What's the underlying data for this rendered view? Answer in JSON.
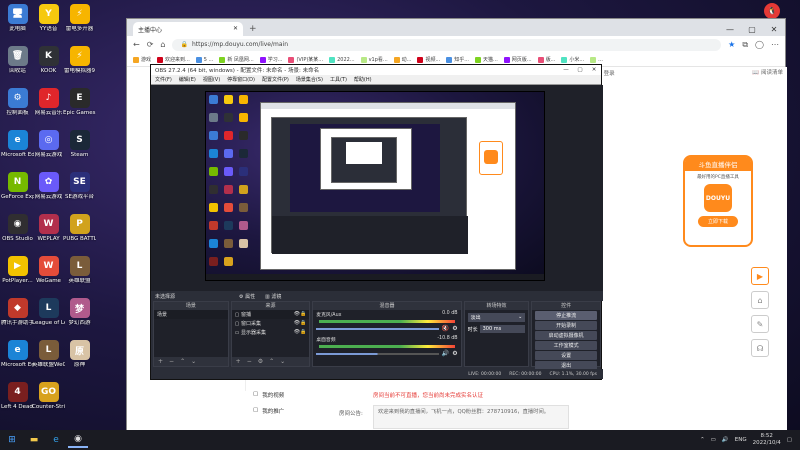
{
  "desktop": {
    "icons": [
      {
        "label": "此电脑",
        "glyph": "🖥",
        "color": "#3b7bd4"
      },
      {
        "label": "YY语音",
        "glyph": "Y",
        "color": "#f6c90e"
      },
      {
        "label": "雷电多开器",
        "glyph": "⚡",
        "color": "#f7b500"
      },
      {
        "label": "回收站",
        "glyph": "🗑",
        "color": "#6c7a89"
      },
      {
        "label": "KOOK",
        "glyph": "K",
        "color": "#2f3136"
      },
      {
        "label": "雷电模拟器9",
        "glyph": "⚡",
        "color": "#f7b500"
      },
      {
        "label": "控制面板",
        "glyph": "⚙",
        "color": "#3b7bd4"
      },
      {
        "label": "网易云音乐",
        "glyph": "♪",
        "color": "#e0262b"
      },
      {
        "label": "Epic Games Launcher",
        "glyph": "E",
        "color": "#2a2a2a"
      },
      {
        "label": "Microsoft Edge",
        "glyph": "e",
        "color": "#1b84d6"
      },
      {
        "label": "网易云游戏",
        "glyph": "◎",
        "color": "#5b6af0"
      },
      {
        "label": "Steam",
        "glyph": "S",
        "color": "#1b2838"
      },
      {
        "label": "GeForce Experience",
        "glyph": "N",
        "color": "#76b900"
      },
      {
        "label": "网易云游戏",
        "glyph": "✿",
        "color": "#6a5af9"
      },
      {
        "label": "SE游戏平台",
        "glyph": "SE",
        "color": "#2b2f7a"
      },
      {
        "label": "OBS Studio",
        "glyph": "◉",
        "color": "#302e31"
      },
      {
        "label": "WEPLAY",
        "glyph": "W",
        "color": "#b22f4c"
      },
      {
        "label": "PUBG BATTLEGR...",
        "glyph": "P",
        "color": "#d1a21d"
      },
      {
        "label": "PotPlayer...",
        "glyph": "▶",
        "color": "#f2c200"
      },
      {
        "label": "WeGame",
        "glyph": "W",
        "color": "#e44c3a"
      },
      {
        "label": "英雄联盟",
        "glyph": "L",
        "color": "#7a5c3a"
      },
      {
        "label": "腾讯手游助手",
        "glyph": "◆",
        "color": "#c0392b"
      },
      {
        "label": "League of Legends",
        "glyph": "L",
        "color": "#1d3a5c"
      },
      {
        "label": "梦幻西游",
        "glyph": "梦",
        "color": "#b05a8c"
      },
      {
        "label": "Microsoft Edge",
        "glyph": "e",
        "color": "#1b84d6"
      },
      {
        "label": "英雄联盟WeGame版",
        "glyph": "L",
        "color": "#7a5c3a"
      },
      {
        "label": "原神",
        "glyph": "原",
        "color": "#d8c3a5"
      },
      {
        "label": "Left 4 Dead 2",
        "glyph": "4",
        "color": "#7a1f1f"
      },
      {
        "label": "Counter-Strike Global Off...",
        "glyph": "GO",
        "color": "#d8a21d"
      }
    ]
  },
  "browser": {
    "tab_title": "主播中心",
    "url": "https://mp.douyu.com/live/main",
    "bookmarks": [
      "游戏",
      "欢迎来到...",
      "5 ...",
      "新 凤凰网...",
      "学习...",
      "(VIP)某某...",
      "2022...",
      "v1p看...",
      "动...",
      "视频...",
      "知乎...",
      "天猫...",
      "网页版...",
      "版...",
      "小米...",
      "..."
    ],
    "user_icon_label": "登录",
    "reading_list": "阅读清单",
    "promo": {
      "title": "斗鱼直播伴侣",
      "subtitle": "最好用的PC直播工具",
      "logo_text": "DOUYU",
      "download": "立即下载"
    },
    "menu": [
      {
        "label": "我的视频",
        "icon": "▢"
      },
      {
        "label": "我的推广",
        "icon": "▢"
      }
    ],
    "red_notice": "房间当前不可直播，您当前尚未完成实名认证",
    "announce_label": "房间公告:",
    "announce_text": "欢迎来到我的直播间，飞机一点，QQ粉丝群：278710916，直播时间。"
  },
  "obs": {
    "title": "OBS 27.2.4 (64 bit, windows) - 配置文件: 未命名 - 场景: 未命名",
    "menu": [
      "文件(F)",
      "编辑(E)",
      "视图(V)",
      "停靠窗口(D)",
      "配置文件(P)",
      "场景集合(S)",
      "工具(T)",
      "帮助(H)"
    ],
    "preview_label": "未选择源",
    "tools": {
      "props": "属性",
      "filters": "滤镜"
    },
    "docks": {
      "scenes": {
        "title": "场景",
        "items": [
          "场景"
        ]
      },
      "sources": {
        "title": "来源",
        "items": [
          "窗捕",
          "窗口采集",
          "显示器采集"
        ]
      },
      "mixer": {
        "title": "混音器",
        "channels": [
          {
            "name": "麦克风/Aux",
            "db": "0.0 dB"
          },
          {
            "name": "桌面音频",
            "db": "-10.8 dB"
          }
        ]
      },
      "transitions": {
        "title": "转场特效",
        "type": "淡出",
        "duration_label": "时长",
        "duration": "300 ms"
      },
      "controls": {
        "title": "控件",
        "buttons": [
          "停止推流",
          "开始录制",
          "启动虚拟摄像机",
          "工作室模式",
          "设置",
          "退出"
        ]
      }
    },
    "status": {
      "live": "LIVE: 00:00:00",
      "rec": "REC: 00:00:00",
      "cpu": "CPU: 1.1%, 30.00 fps"
    }
  },
  "taskbar": {
    "lang": "ENG",
    "time": "8:52",
    "date": "2022/10/4"
  },
  "watermark": "斗鱼"
}
